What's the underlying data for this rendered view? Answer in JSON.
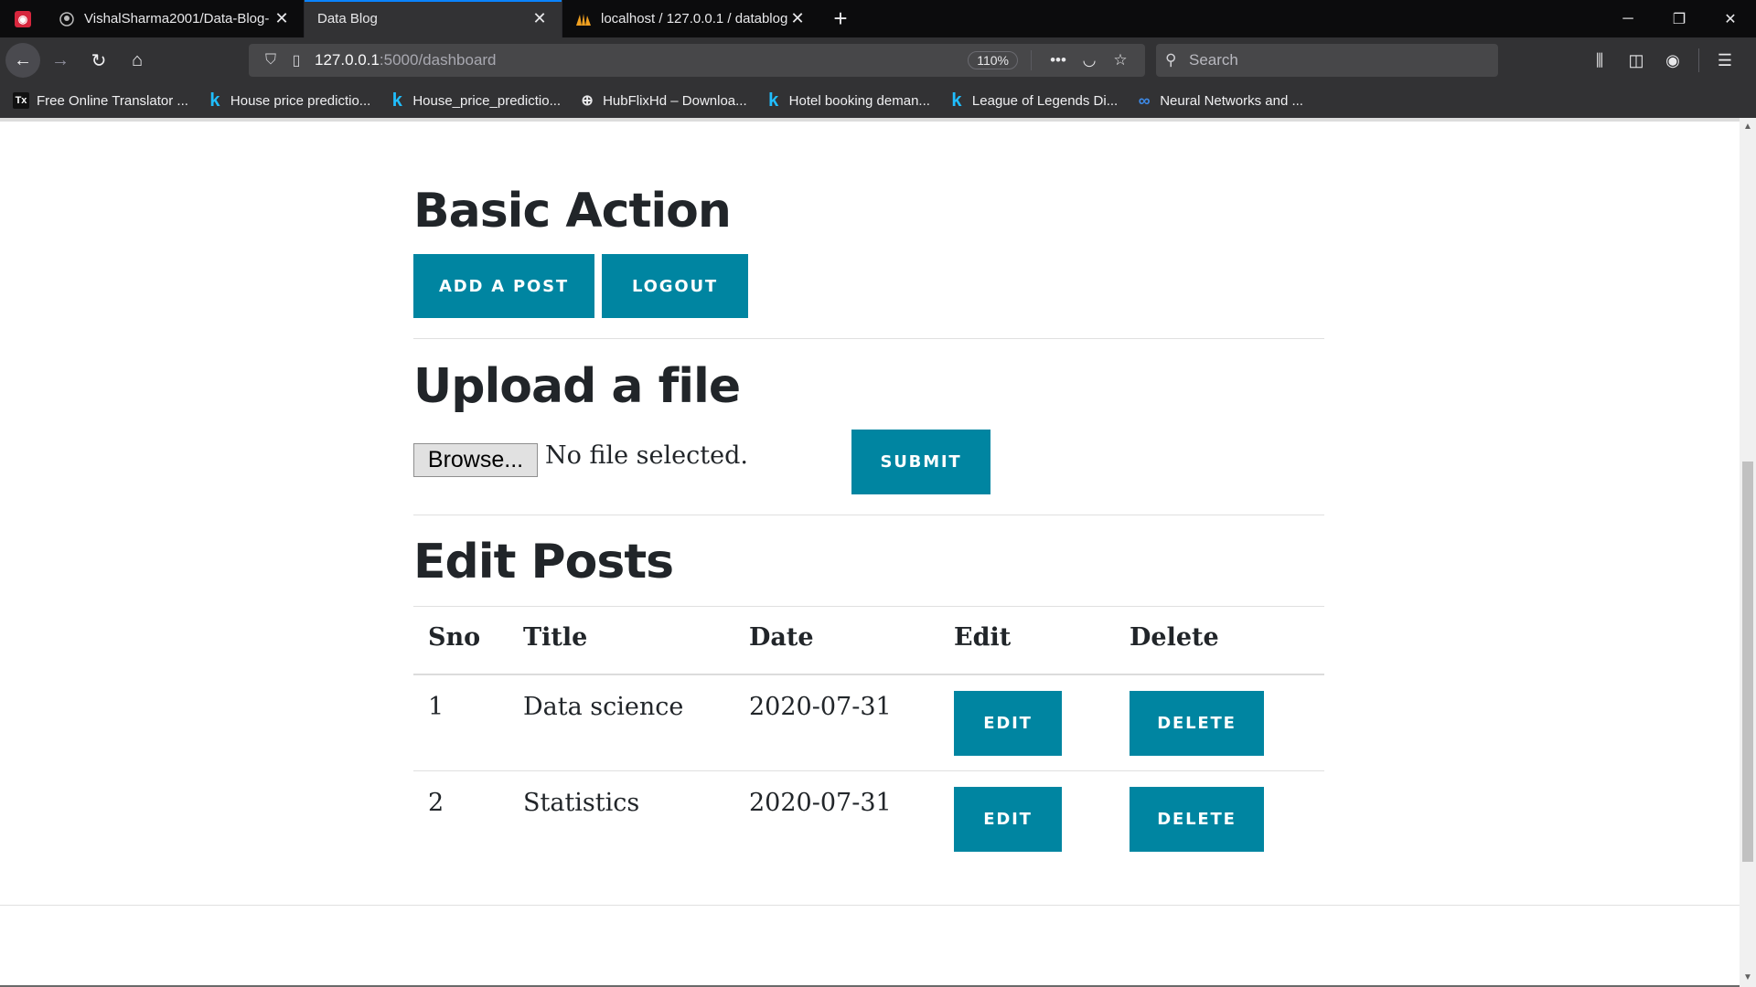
{
  "browser": {
    "tabs": [
      {
        "title": "VishalSharma2001/Data-Blog-",
        "favicon": "github-icon",
        "active": false
      },
      {
        "title": "Data Blog",
        "favicon": "",
        "active": true
      },
      {
        "title": "localhost / 127.0.0.1 / datablog",
        "favicon": "phpmyadmin-icon",
        "active": false
      }
    ],
    "url_host": "127.0.0.1",
    "url_path": ":5000/dashboard",
    "zoom": "110%",
    "search_placeholder": "Search",
    "bookmarks": [
      {
        "label": "Free Online Translator ...",
        "icon": "tx-icon"
      },
      {
        "label": "House price predictio...",
        "icon": "kaggle-icon"
      },
      {
        "label": "House_price_predictio...",
        "icon": "kaggle-icon"
      },
      {
        "label": "HubFlixHd – Downloa...",
        "icon": "globe-icon"
      },
      {
        "label": "Hotel booking deman...",
        "icon": "kaggle-icon"
      },
      {
        "label": "League of Legends Di...",
        "icon": "kaggle-icon"
      },
      {
        "label": "Neural Networks and ...",
        "icon": "infinity-icon"
      }
    ]
  },
  "page": {
    "basic_action": {
      "heading": "Basic Action",
      "add_post_label": "ADD A POST",
      "logout_label": "LOGOUT"
    },
    "upload": {
      "heading": "Upload a file",
      "browse_label": "Browse...",
      "no_file_text": "No file selected.",
      "submit_label": "SUBMIT"
    },
    "edit_posts": {
      "heading": "Edit Posts",
      "columns": [
        "Sno",
        "Title",
        "Date",
        "Edit",
        "Delete"
      ],
      "rows": [
        {
          "sno": "1",
          "title": "Data science",
          "date": "2020-07-31",
          "edit_label": "EDIT",
          "delete_label": "DELETE"
        },
        {
          "sno": "2",
          "title": "Statistics",
          "date": "2020-07-31",
          "edit_label": "EDIT",
          "delete_label": "DELETE"
        }
      ]
    }
  },
  "colors": {
    "button": "#0085a1",
    "heading": "#212529",
    "tab_accent": "#0a84ff"
  }
}
